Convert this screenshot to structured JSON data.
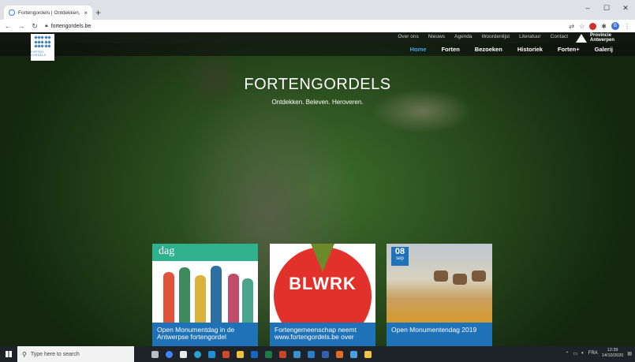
{
  "browser": {
    "tab_title": "Fortengordels | Ontdekken, Beleven...",
    "tab_close": "×",
    "new_tab": "+",
    "url": "fortengordels.be",
    "avatar_initial": "B",
    "window_controls": {
      "minimize": "–",
      "maximize": "☐",
      "close": "✕"
    }
  },
  "site": {
    "logo_text": "FORTEN GORDELS",
    "top_nav": [
      "Over ons",
      "Nieuws",
      "Agenda",
      "Woordenlijst",
      "Literatuur",
      "Contact"
    ],
    "province": {
      "line1": "Provincie",
      "line2": "Antwerpen"
    },
    "main_nav": [
      {
        "label": "Home",
        "active": true
      },
      {
        "label": "Forten",
        "active": false
      },
      {
        "label": "Bezoeken",
        "active": false
      },
      {
        "label": "Historiek",
        "active": false
      },
      {
        "label": "Forten+",
        "active": false
      },
      {
        "label": "Galerij",
        "active": false
      }
    ],
    "hero": {
      "title": "FORTENGORDELS",
      "subtitle": "Ontdekken. Beleven. Heroveren."
    },
    "cards": [
      {
        "image_word": "dag",
        "caption": "Open Monumentdag in de Antwerpse fortengordel"
      },
      {
        "image_word": "BLWRK",
        "caption": "Fortengemeenschap neemt www.fortengordels.be over"
      },
      {
        "date_day": "08",
        "date_month": "sep",
        "caption": "Open Monumentendag 2019"
      }
    ],
    "colors": {
      "accent": "#1f72b8",
      "active_nav": "#4aa3e0"
    }
  },
  "taskbar": {
    "search_placeholder": "Type here to search",
    "language": "FRA",
    "time": "12:39",
    "date": "14/10/2020"
  }
}
